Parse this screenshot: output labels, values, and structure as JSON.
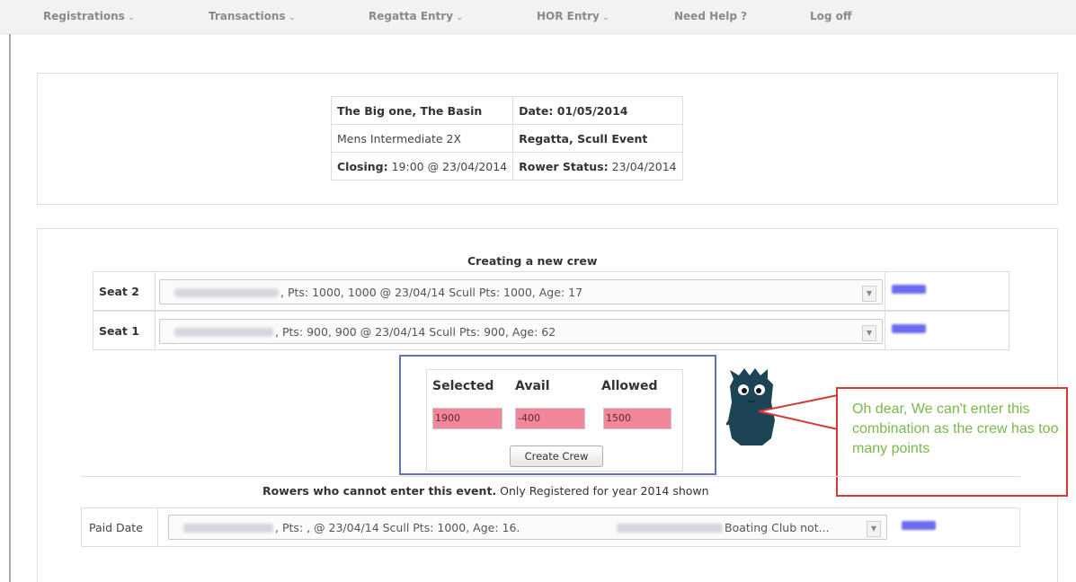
{
  "nav": {
    "items": [
      "Registrations",
      "Transactions",
      "Regatta Entry",
      "HOR Entry",
      "Need Help ?",
      "Log off"
    ],
    "caret": "⌄"
  },
  "event": {
    "name": "The Big one, The Basin",
    "date_label": "Date:",
    "date": "01/05/2014",
    "category": "Mens Intermediate 2X",
    "type": "Regatta, Scull Event",
    "closing_label": "Closing:",
    "closing": "19:00 @ 23/04/2014",
    "rower_status_label": "Rower Status:",
    "rower_status": "23/04/2014"
  },
  "crew": {
    "title": "Creating a new crew",
    "seats": [
      {
        "label": "Seat 2",
        "text": ", Pts: 1000, 1000 @ 23/04/14 Scull Pts: 1000, Age: 17"
      },
      {
        "label": "Seat 1",
        "text": ", Pts: 900, 900 @ 23/04/14 Scull Pts: 900, Age: 62"
      }
    ]
  },
  "points": {
    "headers": [
      "Selected",
      "Avail",
      "Allowed"
    ],
    "values": [
      "1900",
      "-400",
      "1500"
    ],
    "button": "Create Crew"
  },
  "callout": {
    "text": "Oh dear, We can't enter this combination as the crew has too many points"
  },
  "cannot": {
    "bold": "Rowers who cannot enter this event.",
    "note": " Only Registered for year 2014 shown",
    "paid_label": "Paid Date",
    "row_text": ", Pts: , @ 23/04/14 Scull Pts: 1000, Age: 16.",
    "row_tail": "Boating Club not..."
  },
  "colors": {
    "error_fill": "#f2869a",
    "box_border": "#5b76b6",
    "callout_border": "#d43a3a",
    "callout_text": "#7ab84a"
  }
}
